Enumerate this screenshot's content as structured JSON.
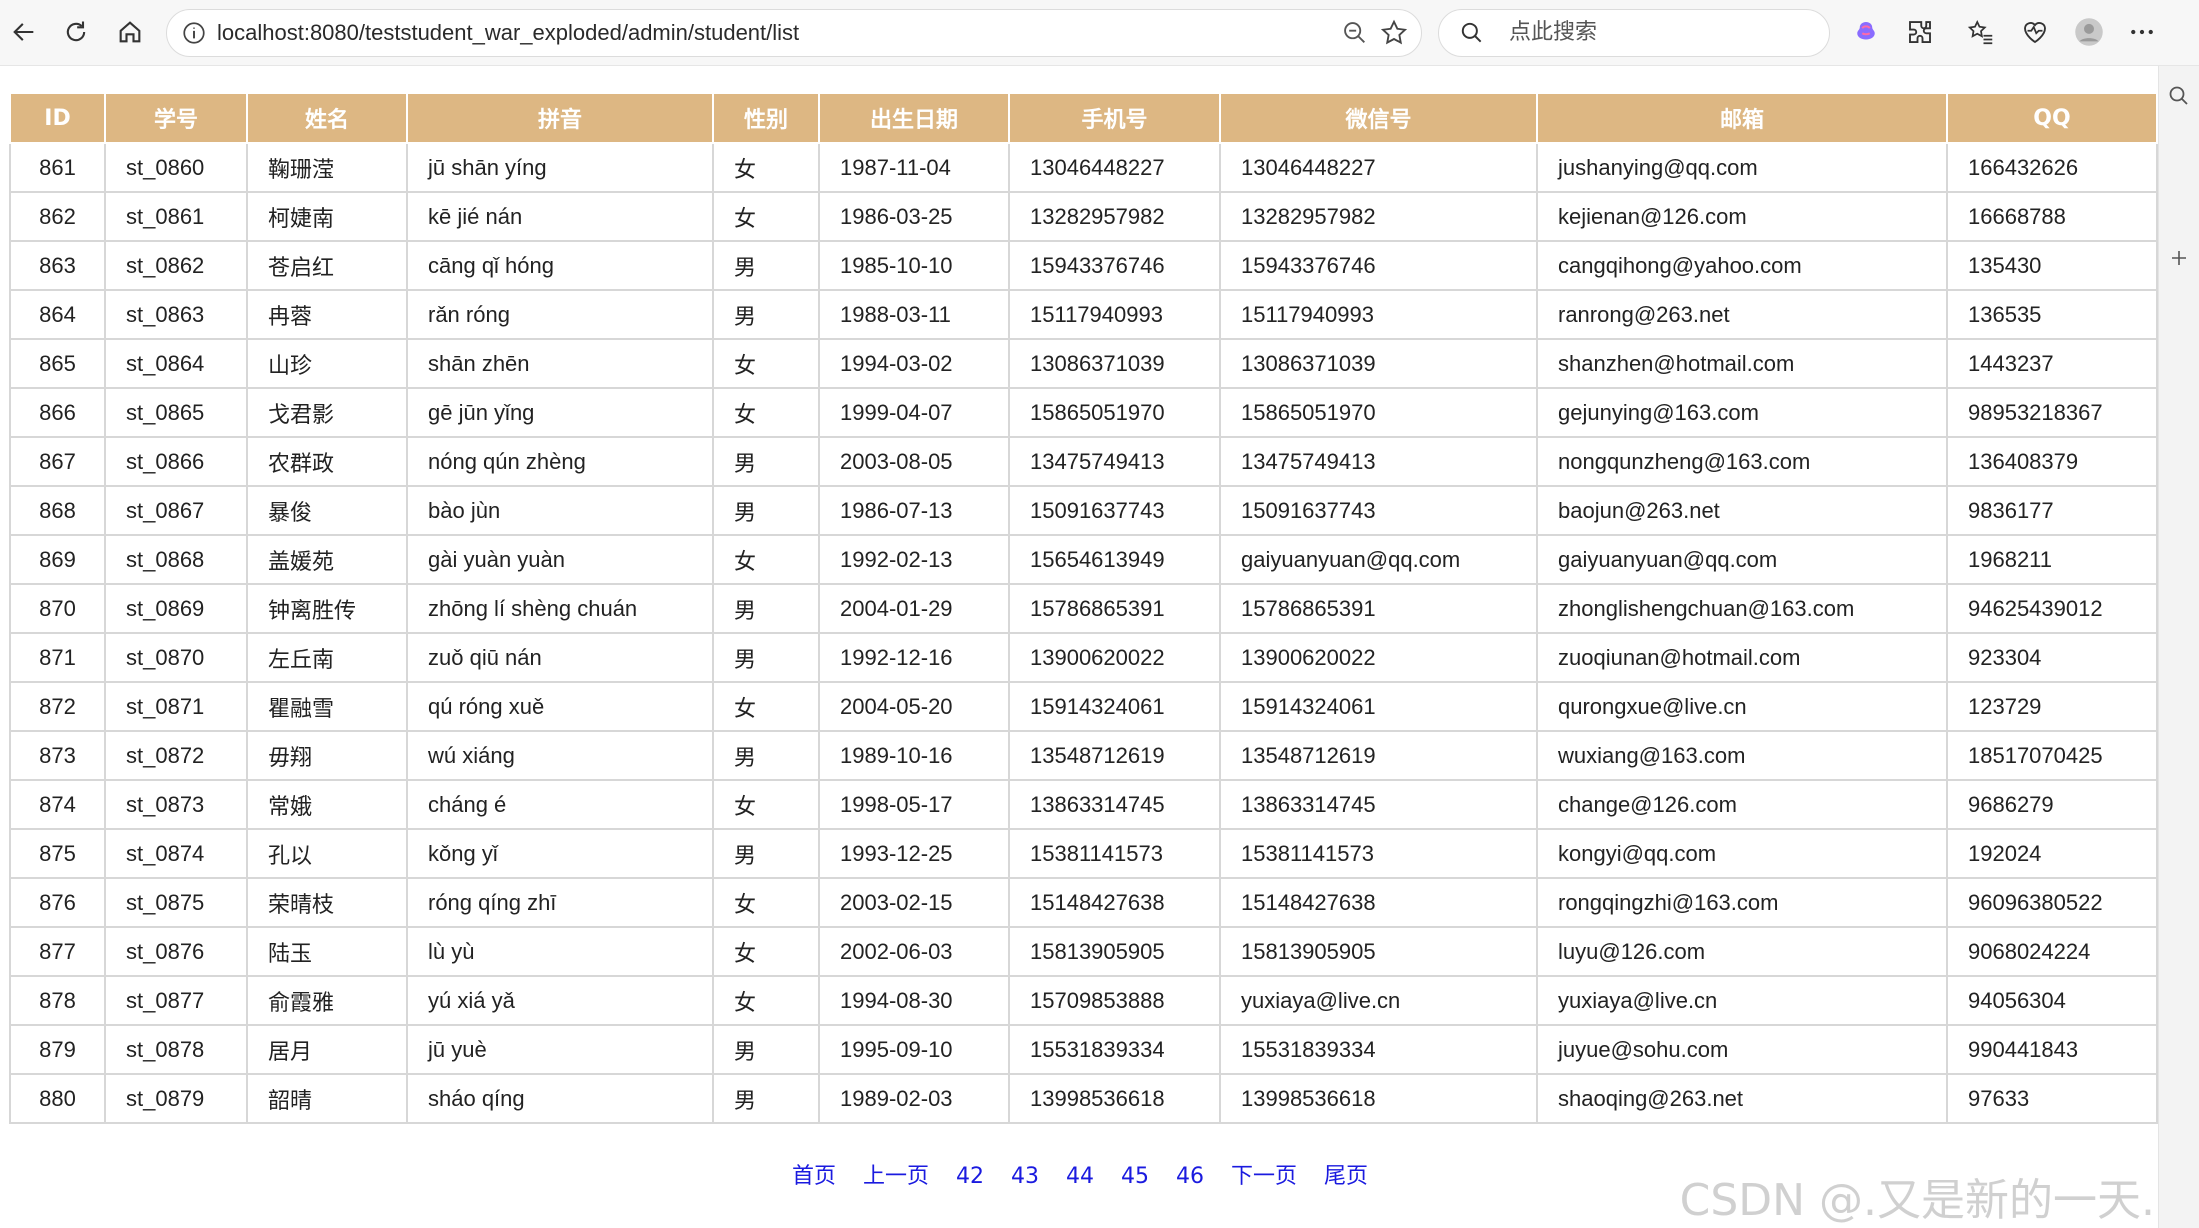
{
  "browser": {
    "url": "localhost:8080/teststudent_war_exploded/admin/student/list",
    "search_placeholder": "点此搜索"
  },
  "table": {
    "headers": [
      "ID",
      "学号",
      "姓名",
      "拼音",
      "性别",
      "出生日期",
      "手机号",
      "微信号",
      "邮箱",
      "QQ"
    ],
    "rows": [
      [
        "861",
        "st_0860",
        "鞠珊滢",
        "jū shān yíng",
        "女",
        "1987-11-04",
        "13046448227",
        "13046448227",
        "jushanying@qq.com",
        "166432626"
      ],
      [
        "862",
        "st_0861",
        "柯婕南",
        "kē jié nán",
        "女",
        "1986-03-25",
        "13282957982",
        "13282957982",
        "kejienan@126.com",
        "16668788"
      ],
      [
        "863",
        "st_0862",
        "苍启红",
        "cāng qǐ hóng",
        "男",
        "1985-10-10",
        "15943376746",
        "15943376746",
        "cangqihong@yahoo.com",
        "135430"
      ],
      [
        "864",
        "st_0863",
        "冉蓉",
        "rǎn róng",
        "男",
        "1988-03-11",
        "15117940993",
        "15117940993",
        "ranrong@263.net",
        "136535"
      ],
      [
        "865",
        "st_0864",
        "山珍",
        "shān zhēn",
        "女",
        "1994-03-02",
        "13086371039",
        "13086371039",
        "shanzhen@hotmail.com",
        "1443237"
      ],
      [
        "866",
        "st_0865",
        "戈君影",
        "gē jūn yǐng",
        "女",
        "1999-04-07",
        "15865051970",
        "15865051970",
        "gejunying@163.com",
        "98953218367"
      ],
      [
        "867",
        "st_0866",
        "农群政",
        "nóng qún zhèng",
        "男",
        "2003-08-05",
        "13475749413",
        "13475749413",
        "nongqunzheng@163.com",
        "136408379"
      ],
      [
        "868",
        "st_0867",
        "暴俊",
        "bào jùn",
        "男",
        "1986-07-13",
        "15091637743",
        "15091637743",
        "baojun@263.net",
        "9836177"
      ],
      [
        "869",
        "st_0868",
        "盖媛苑",
        "gài yuàn yuàn",
        "女",
        "1992-02-13",
        "15654613949",
        "gaiyuanyuan@qq.com",
        "gaiyuanyuan@qq.com",
        "1968211"
      ],
      [
        "870",
        "st_0869",
        "钟离胜传",
        "zhōng lí shèng chuán",
        "男",
        "2004-01-29",
        "15786865391",
        "15786865391",
        "zhonglishengchuan@163.com",
        "94625439012"
      ],
      [
        "871",
        "st_0870",
        "左丘南",
        "zuǒ qiū nán",
        "男",
        "1992-12-16",
        "13900620022",
        "13900620022",
        "zuoqiunan@hotmail.com",
        "923304"
      ],
      [
        "872",
        "st_0871",
        "瞿融雪",
        "qú róng xuě",
        "女",
        "2004-05-20",
        "15914324061",
        "15914324061",
        "qurongxue@live.cn",
        "123729"
      ],
      [
        "873",
        "st_0872",
        "毋翔",
        "wú xiáng",
        "男",
        "1989-10-16",
        "13548712619",
        "13548712619",
        "wuxiang@163.com",
        "18517070425"
      ],
      [
        "874",
        "st_0873",
        "常娥",
        "cháng é",
        "女",
        "1998-05-17",
        "13863314745",
        "13863314745",
        "change@126.com",
        "9686279"
      ],
      [
        "875",
        "st_0874",
        "孔以",
        "kǒng yǐ",
        "男",
        "1993-12-25",
        "15381141573",
        "15381141573",
        "kongyi@qq.com",
        "192024"
      ],
      [
        "876",
        "st_0875",
        "荣晴枝",
        "róng qíng zhī",
        "女",
        "2003-02-15",
        "15148427638",
        "15148427638",
        "rongqingzhi@163.com",
        "96096380522"
      ],
      [
        "877",
        "st_0876",
        "陆玉",
        "lù yù",
        "女",
        "2002-06-03",
        "15813905905",
        "15813905905",
        "luyu@126.com",
        "9068024224"
      ],
      [
        "878",
        "st_0877",
        "俞霞雅",
        "yú xiá yǎ",
        "女",
        "1994-08-30",
        "15709853888",
        "yuxiaya@live.cn",
        "yuxiaya@live.cn",
        "94056304"
      ],
      [
        "879",
        "st_0878",
        "居月",
        "jū yuè",
        "男",
        "1995-09-10",
        "15531839334",
        "15531839334",
        "juyue@sohu.com",
        "990441843"
      ],
      [
        "880",
        "st_0879",
        "韶晴",
        "sháo qíng",
        "男",
        "1989-02-03",
        "13998536618",
        "13998536618",
        "shaoqing@263.net",
        "97633"
      ]
    ]
  },
  "pagination": {
    "first": "首页",
    "prev": "上一页",
    "pages": [
      "42",
      "43",
      "44",
      "45",
      "46"
    ],
    "next": "下一页",
    "last": "尾页"
  },
  "watermark": "CSDN @.又是新的一天."
}
